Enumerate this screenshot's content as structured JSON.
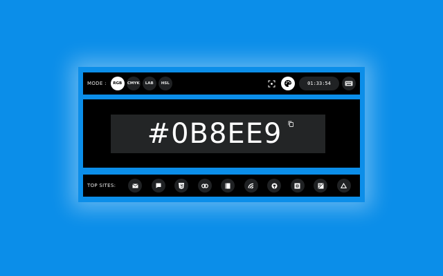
{
  "theme": {
    "accent": "#0B8EE9",
    "bar_bg": "#000000",
    "button_bg": "#202224"
  },
  "header": {
    "mode_label": "MODE :",
    "modes": [
      {
        "label": "RGB",
        "active": true
      },
      {
        "label": "CMYK",
        "active": false
      },
      {
        "label": "LAB",
        "active": false
      },
      {
        "label": "HSL",
        "active": false
      }
    ],
    "tools": [
      "screenshot-icon",
      "palette-icon",
      "keyboard-icon"
    ],
    "clock": "01:33:54"
  },
  "main": {
    "hex_value": "#0B8EE9",
    "copy_icon": "copy-icon"
  },
  "footer": {
    "sites_label": "TOP SITES:",
    "sites": [
      "mail-icon",
      "chat-icon",
      "html-badge-icon",
      "link-icon",
      "book-icon",
      "swirl-icon",
      "github-icon",
      "square-logo-icon",
      "image-icon",
      "triangle-icon"
    ]
  }
}
